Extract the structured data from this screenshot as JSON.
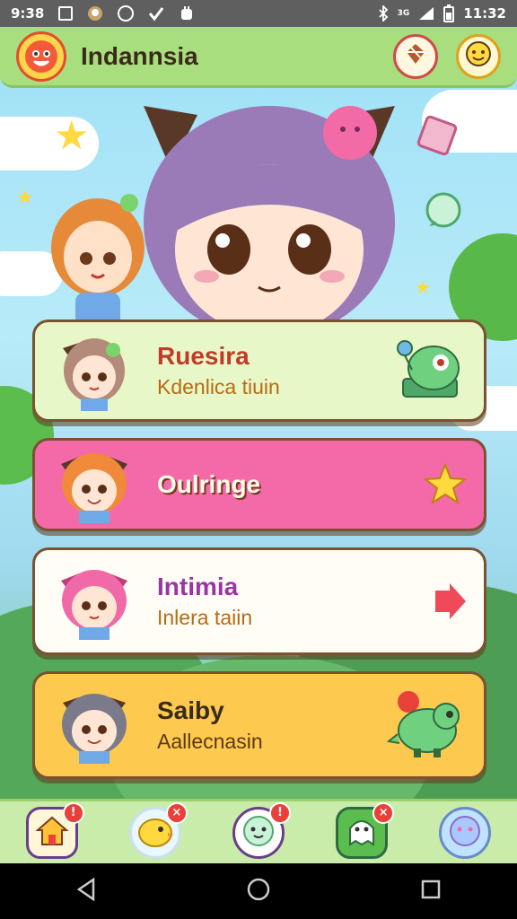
{
  "status_bar": {
    "time_left": "9:38",
    "signal_text": "3G",
    "time_right": "11:32"
  },
  "header": {
    "title": "Indannsia"
  },
  "cards": [
    {
      "title": "Ruesira",
      "subtitle": "Kdenlica tiuin",
      "bg": "#e8f7c8",
      "title_color": "#c23b2a",
      "sub_color": "#b86b12",
      "trail": "frog-mascot-icon"
    },
    {
      "title": "Oulringe",
      "subtitle": "",
      "bg": "#f46aa8",
      "title_color": "#fffbe8",
      "sub_color": "#fffbe8",
      "trail": "star-icon"
    },
    {
      "title": "Intimia",
      "subtitle": "Inlera taiin",
      "bg": "#fffdf6",
      "title_color": "#9b35a6",
      "sub_color": "#b86b12",
      "trail": "arrow-right-icon"
    },
    {
      "title": "Saiby",
      "subtitle": "Aallecnasin",
      "bg": "#fdc94f",
      "title_color": "#3a2a1a",
      "sub_color": "#5a3a1a",
      "trail": "dino-mascot-icon"
    }
  ],
  "bottom_nav": [
    {
      "name": "home",
      "badge": "!"
    },
    {
      "name": "chick",
      "badge": "×"
    },
    {
      "name": "bun",
      "badge": "!"
    },
    {
      "name": "ghost",
      "badge": "×"
    },
    {
      "name": "bubble",
      "badge": ""
    }
  ],
  "colors": {
    "accent_green": "#a8de7e",
    "accent_pink": "#f46aa8",
    "accent_yellow": "#fdc94f",
    "outline_brown": "#7a5230"
  }
}
